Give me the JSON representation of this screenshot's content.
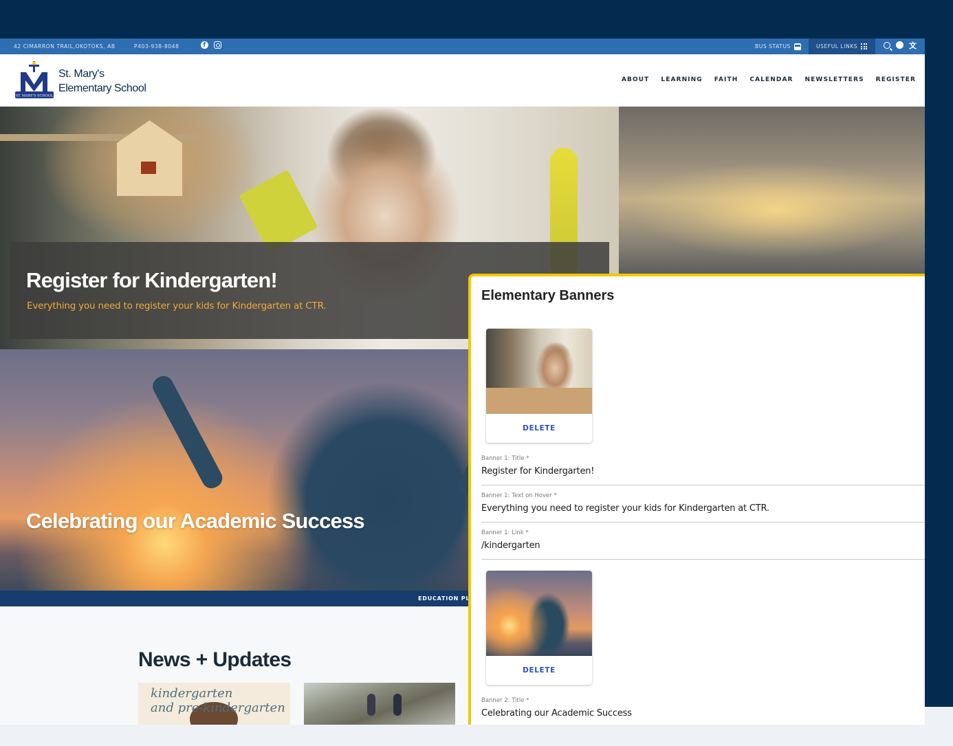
{
  "topbar": {
    "address": "42 CIMARRON TRAIL,OKOTOKS, AB",
    "phone": "P403-938-8048",
    "bus_status": "BUS STATUS",
    "useful_links": "USEFUL LINKS"
  },
  "header": {
    "school_name_line1": "St. Mary's",
    "school_name_line2": "Elementary School",
    "logo_text": "ST. MARY'S SCHOOL"
  },
  "nav": [
    "ABOUT",
    "LEARNING",
    "FAITH",
    "CALENDAR",
    "NEWSLETTERS",
    "REGISTER"
  ],
  "hero": {
    "banner1_title": "Register for Kindergarten!",
    "banner1_subtitle": "Everything you need to register your kids for Kindergarten at CTR.",
    "banner2_title": "Celebrating our Academic Success",
    "edbar_text": "EDUCATION PLAN"
  },
  "news": {
    "title": "News + Updates",
    "card1_line1": "kindergarten",
    "card1_line2": "and pre-kindergarten"
  },
  "cms": {
    "title": "Elementary Banners",
    "delete_label": "DELETE",
    "fields": [
      {
        "label": "Banner 1: Title *",
        "value": "Register for Kindergarten!"
      },
      {
        "label": "Banner 1: Text on Hover *",
        "value": "Everything you need to register your kids for Kindergarten at CTR."
      },
      {
        "label": "Banner 1: Link *",
        "value": "/kindergarten"
      },
      {
        "label": "Banner 2: Title *",
        "value": "Celebrating our Academic Success"
      }
    ]
  },
  "colors": {
    "navy": "#032b4f",
    "topbar_blue": "#2f6db1",
    "accent_orange": "#f3a83a",
    "highlight_yellow": "#f4c800",
    "delete_blue": "#2c55b8"
  }
}
